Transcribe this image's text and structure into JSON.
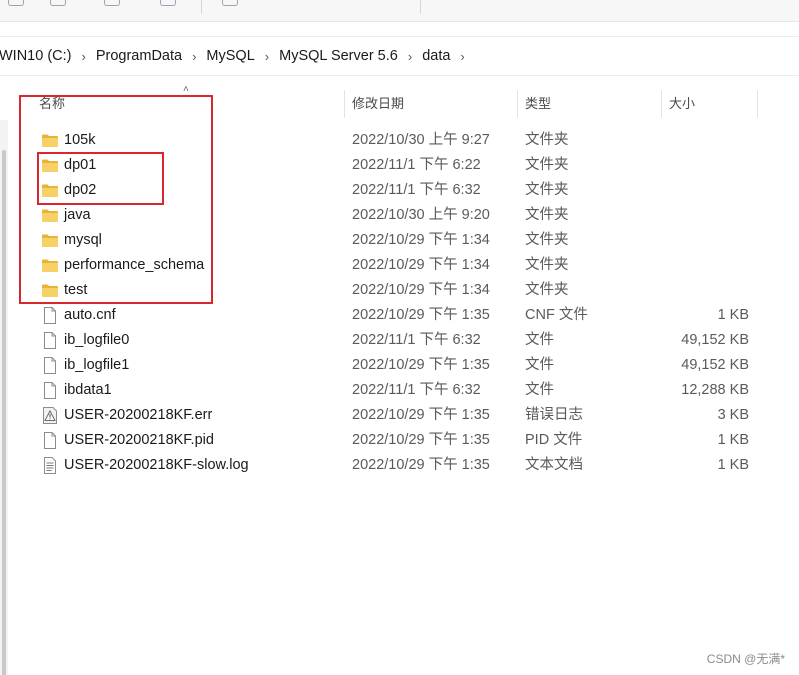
{
  "breadcrumb": [
    "WIN10 (C:)",
    "ProgramData",
    "MySQL",
    "MySQL Server 5.6",
    "data"
  ],
  "columns": {
    "name": "名称",
    "date": "修改日期",
    "type": "类型",
    "size": "大小"
  },
  "files": [
    {
      "name": "105k",
      "date": "2022/10/30 上午 9:27",
      "type": "文件夹",
      "size": "",
      "icon": "folder-icon"
    },
    {
      "name": "dp01",
      "date": "2022/11/1 下午 6:22",
      "type": "文件夹",
      "size": "",
      "icon": "folder-icon"
    },
    {
      "name": "dp02",
      "date": "2022/11/1 下午 6:32",
      "type": "文件夹",
      "size": "",
      "icon": "folder-icon"
    },
    {
      "name": "java",
      "date": "2022/10/30 上午 9:20",
      "type": "文件夹",
      "size": "",
      "icon": "folder-icon"
    },
    {
      "name": "mysql",
      "date": "2022/10/29 下午 1:34",
      "type": "文件夹",
      "size": "",
      "icon": "folder-icon"
    },
    {
      "name": "performance_schema",
      "date": "2022/10/29 下午 1:34",
      "type": "文件夹",
      "size": "",
      "icon": "folder-icon"
    },
    {
      "name": "test",
      "date": "2022/10/29 下午 1:34",
      "type": "文件夹",
      "size": "",
      "icon": "folder-icon"
    },
    {
      "name": "auto.cnf",
      "date": "2022/10/29 下午 1:35",
      "type": "CNF 文件",
      "size": "1 KB",
      "icon": "file-icon"
    },
    {
      "name": "ib_logfile0",
      "date": "2022/11/1 下午 6:32",
      "type": "文件",
      "size": "49,152 KB",
      "icon": "file-icon"
    },
    {
      "name": "ib_logfile1",
      "date": "2022/10/29 下午 1:35",
      "type": "文件",
      "size": "49,152 KB",
      "icon": "file-icon"
    },
    {
      "name": "ibdata1",
      "date": "2022/11/1 下午 6:32",
      "type": "文件",
      "size": "12,288 KB",
      "icon": "file-icon"
    },
    {
      "name": "USER-20200218KF.err",
      "date": "2022/10/29 下午 1:35",
      "type": "错误日志",
      "size": "3 KB",
      "icon": "error-log-icon"
    },
    {
      "name": "USER-20200218KF.pid",
      "date": "2022/10/29 下午 1:35",
      "type": "PID 文件",
      "size": "1 KB",
      "icon": "file-icon"
    },
    {
      "name": "USER-20200218KF-slow.log",
      "date": "2022/10/29 下午 1:35",
      "type": "文本文档",
      "size": "1 KB",
      "icon": "text-document-icon"
    }
  ],
  "watermark": "CSDN @无满*",
  "colors": {
    "highlight": "#d9272e",
    "folder": "#f4c542"
  }
}
